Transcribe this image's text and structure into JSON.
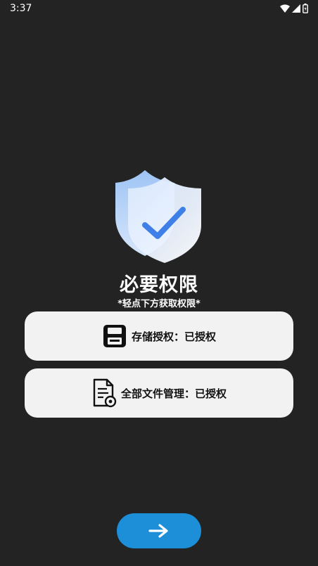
{
  "status_bar": {
    "time": "3:37",
    "icons": [
      "wifi-icon",
      "signal-icon",
      "battery-icon"
    ]
  },
  "header": {
    "icon": "shield-check-icon",
    "title": "必要权限",
    "subtitle": "*轻点下方获取权限*"
  },
  "permissions": [
    {
      "icon": "floppy-disk-icon",
      "label": "存储授权：已授权"
    },
    {
      "icon": "file-settings-icon",
      "label": "全部文件管理：已授权"
    }
  ],
  "next_button": {
    "icon": "arrow-right-icon"
  },
  "colors": {
    "background": "#232323",
    "card": "#f2f2f2",
    "accent": "#1c8fd8",
    "shield_check": "#3f7fe8"
  }
}
